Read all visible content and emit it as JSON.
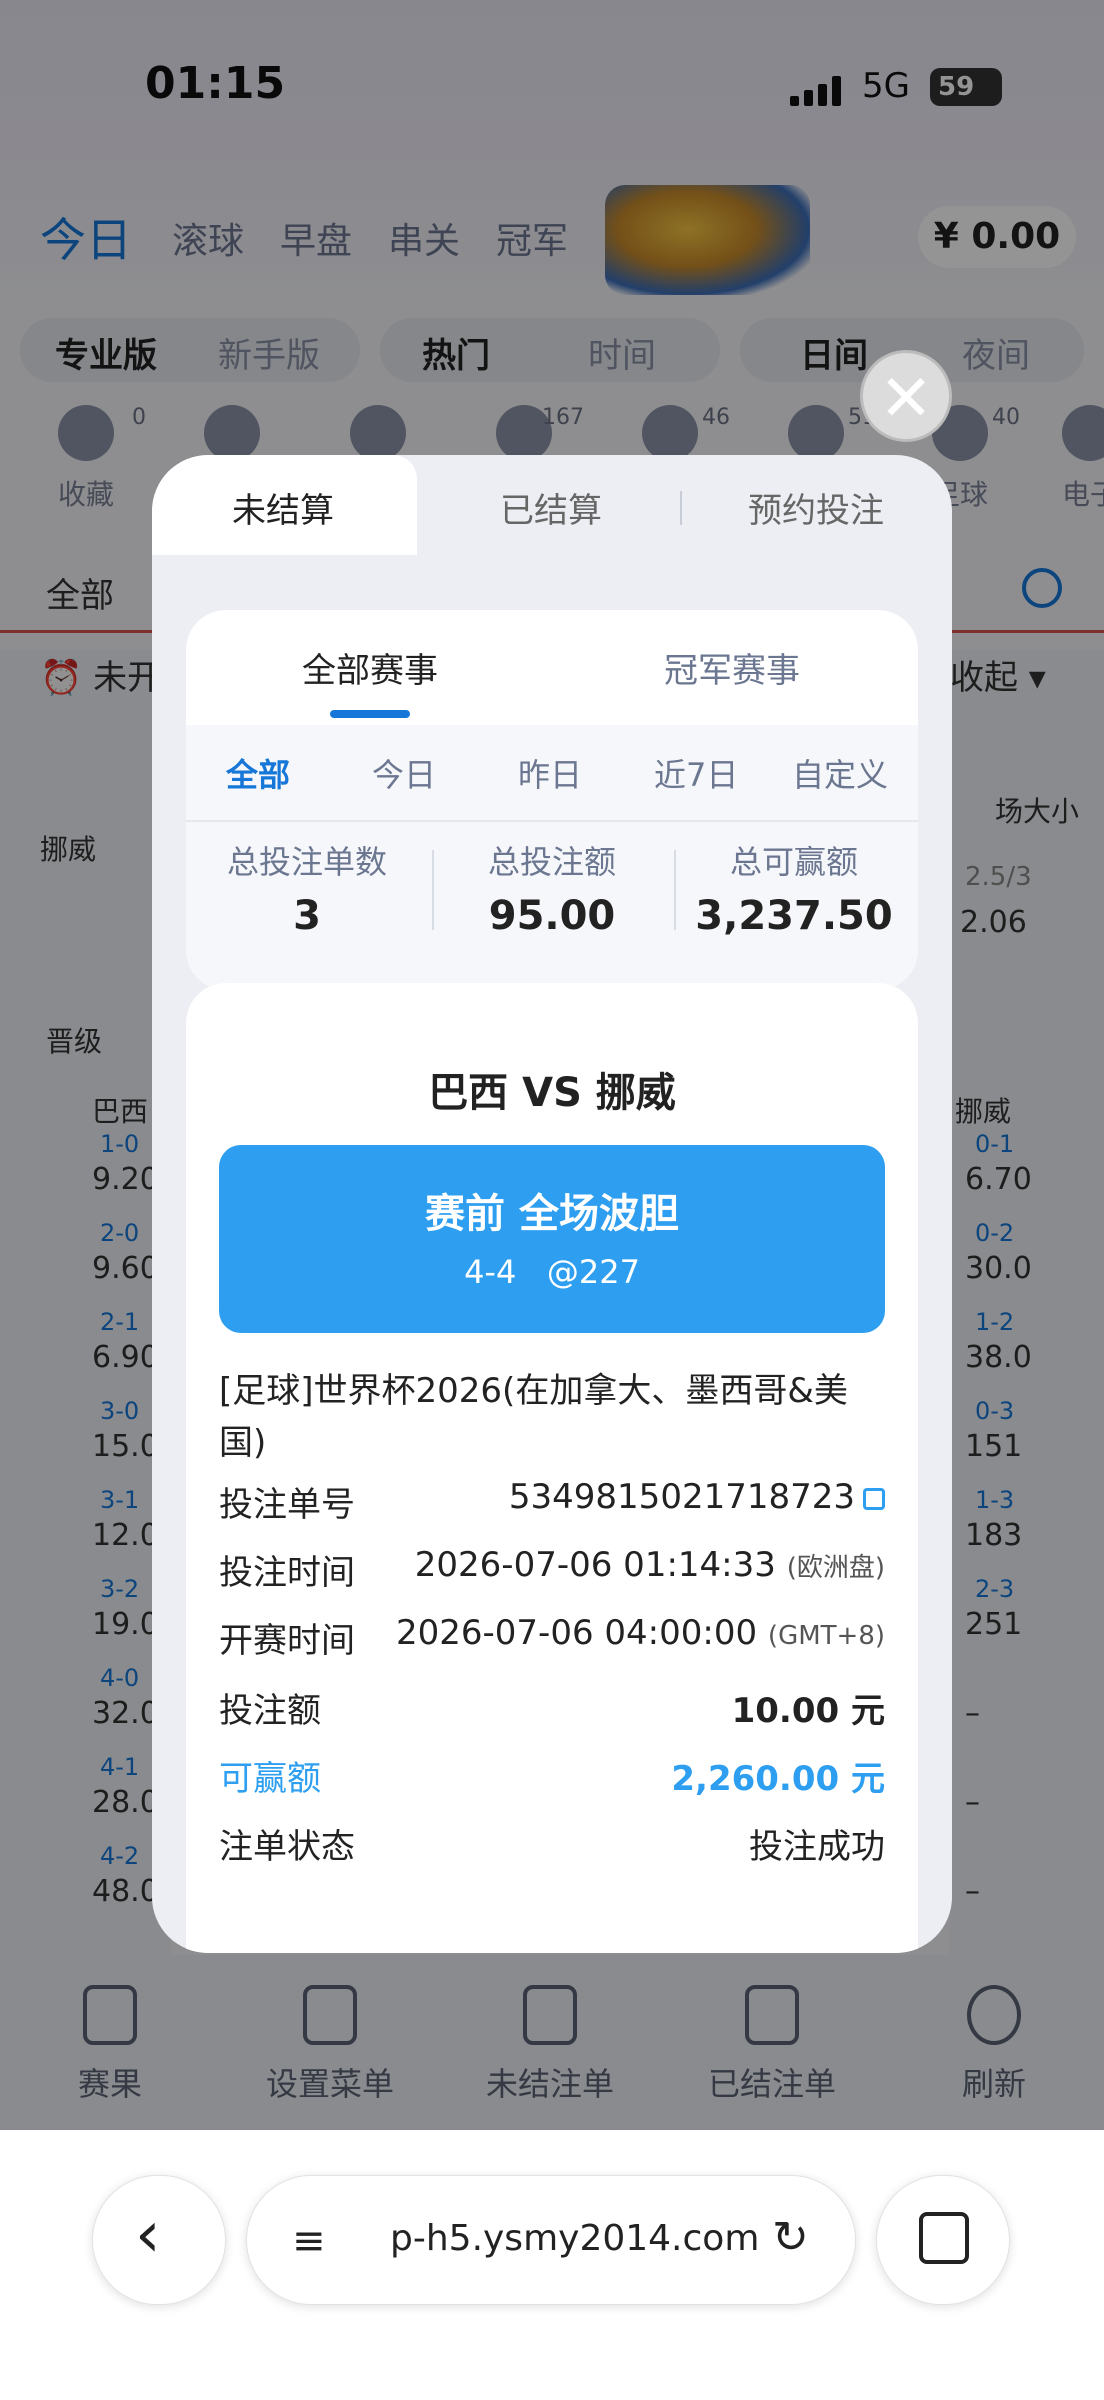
{
  "status": {
    "time": "01:15",
    "network": "5G",
    "battery": "59"
  },
  "header": {
    "tabs": [
      "今日",
      "滚球",
      "早盘",
      "串关",
      "冠军"
    ],
    "balance": "¥ 0.00"
  },
  "mode_tabs": [
    "专业版",
    "新手版"
  ],
  "sort_tabs": [
    "热门",
    "时间"
  ],
  "theme_tabs": [
    "日间",
    "夜间"
  ],
  "sports": [
    {
      "label": "收藏",
      "count": "0"
    },
    {
      "label": "",
      "count": ""
    },
    {
      "label": "",
      "count": ""
    },
    {
      "label": "",
      "count": "167"
    },
    {
      "label": "",
      "count": "46"
    },
    {
      "label": "",
      "count": "51"
    },
    {
      "label": "足球",
      "count": "40"
    },
    {
      "label": "电子",
      "count": ""
    }
  ],
  "filter_all": "全部",
  "bg_strip": {
    "unstarted": "未开",
    "collapse": "收起",
    "team": "挪威",
    "market": "场大小",
    "line": "2.5/3",
    "line_odds": "2.06",
    "advance": "晋级",
    "col_left": "巴西",
    "col_right": "挪威"
  },
  "bg_odds_left": [
    {
      "score": "1-0",
      "odd": "9.20"
    },
    {
      "score": "2-0",
      "odd": "9.60"
    },
    {
      "score": "2-1",
      "odd": "6.90"
    },
    {
      "score": "3-0",
      "odd": "15.0"
    },
    {
      "score": "3-1",
      "odd": "12.0"
    },
    {
      "score": "3-2",
      "odd": "19.0"
    },
    {
      "score": "4-0",
      "odd": "32.0"
    },
    {
      "score": "4-1",
      "odd": "28.0"
    },
    {
      "score": "4-2",
      "odd": "48.0"
    }
  ],
  "bg_odds_right": [
    {
      "score": "0-1",
      "odd": "6.70"
    },
    {
      "score": "0-2",
      "odd": "30.0"
    },
    {
      "score": "1-2",
      "odd": "38.0"
    },
    {
      "score": "0-3",
      "odd": "151"
    },
    {
      "score": "1-3",
      "odd": "183"
    },
    {
      "score": "2-3",
      "odd": "251"
    },
    {
      "score": "",
      "odd": "–"
    },
    {
      "score": "",
      "odd": "–"
    },
    {
      "score": "",
      "odd": "–"
    }
  ],
  "bottom_nav": [
    "赛果",
    "设置菜单",
    "未结注单",
    "已结注单",
    "刷新"
  ],
  "browser": {
    "url": "p-h5.ysmy2014.com"
  },
  "modal": {
    "tabs": [
      "未结算",
      "已结算",
      "预约投注"
    ],
    "event_tabs": [
      "全部赛事",
      "冠军赛事"
    ],
    "filters": [
      "全部",
      "今日",
      "昨日",
      "近7日",
      "自定义"
    ],
    "stats": [
      {
        "label": "总投注单数",
        "value": "3"
      },
      {
        "label": "总投注额",
        "value": "95.00"
      },
      {
        "label": "总可赢额",
        "value": "3,237.50"
      }
    ],
    "bet": {
      "match": "巴西  VS  挪威",
      "market": "赛前 全场波胆",
      "selection": "4-4",
      "odds": "@227",
      "league": "[足球]世界杯2026(在加拿大、墨西哥&美国)",
      "rows": [
        {
          "key": "投注单号",
          "value": "5349815021718723",
          "suffix": ""
        },
        {
          "key": "投注时间",
          "value": "2026-07-06 01:14:33",
          "suffix": "(欧洲盘)"
        },
        {
          "key": "开赛时间",
          "value": "2026-07-06 04:00:00",
          "suffix": "(GMT+8)"
        },
        {
          "key": "投注额",
          "value": "10.00 元",
          "suffix": ""
        },
        {
          "key": "可赢额",
          "value": "2,260.00 元",
          "suffix": ""
        },
        {
          "key": "注单状态",
          "value": "投注成功",
          "suffix": ""
        }
      ]
    }
  },
  "colors": {
    "accent": "#1677d8",
    "bet_box": "#2d9ef0",
    "win_text": "#2d9ef0"
  }
}
